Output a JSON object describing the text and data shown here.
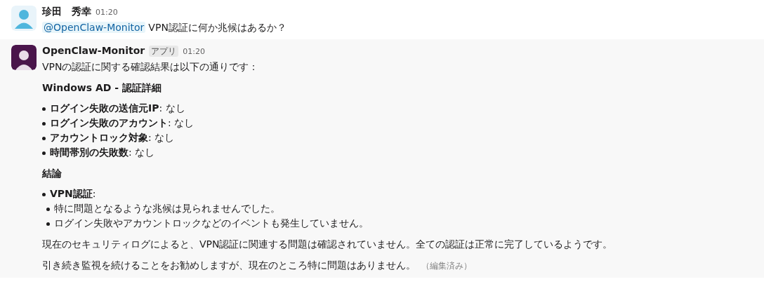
{
  "messages": [
    {
      "author": "珍田　秀幸",
      "time": "01:20",
      "color": "#4fb6dd",
      "hovered": false,
      "blocks": [
        {
          "kind": "mention_line",
          "mention": "@OpenClaw-Monitor",
          "text": "VPN認証に何か兆候はあるか？"
        }
      ]
    },
    {
      "author": "OpenClaw-Monitor",
      "badge": "アプリ",
      "time": "01:20",
      "color": "#4a154b",
      "hovered": true,
      "blocks": [
        {
          "kind": "paragraph",
          "text": "VPNの認証に関する確認結果は以下の通りです："
        },
        {
          "kind": "heading",
          "text": "Windows AD - 認証詳細"
        },
        {
          "kind": "list",
          "items": [
            {
              "text": "**ログイン失敗の送信元IP**: なし"
            },
            {
              "text": "**ログイン失敗のアカウント**: なし"
            },
            {
              "text": "**アカウントロック対象**: なし"
            },
            {
              "text": "**時間帯別の失敗数**: なし"
            }
          ]
        },
        {
          "kind": "heading",
          "text": "結論"
        },
        {
          "kind": "list",
          "items": [
            {
              "text": "**VPN認証**:",
              "children": [
                {
                  "text": "特に問題となるような兆候は見られませんでした。"
                },
                {
                  "text": "ログイン失敗やアカウントロックなどのイベントも発生していません。"
                }
              ]
            }
          ]
        },
        {
          "kind": "paragraph",
          "text": "現在のセキュリティログによると、VPN認証に関連する問題は確認されていません。全ての認証は正常に完了しているようです。"
        },
        {
          "kind": "paragraph",
          "text": "引き続き監視を続けることをお勧めしますが、現在のところ特に問題はありません。",
          "edited": "（編集済み）"
        }
      ]
    }
  ]
}
